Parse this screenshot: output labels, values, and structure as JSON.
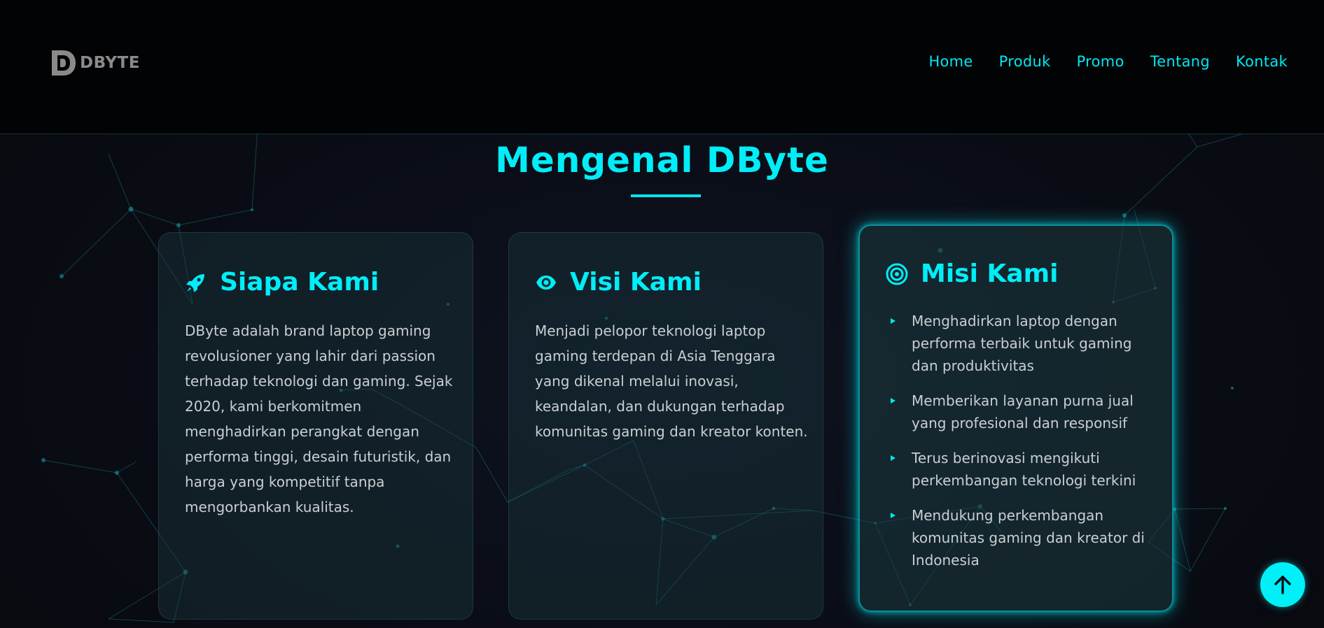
{
  "brand": {
    "logo_text": "DBYTE"
  },
  "nav": {
    "items": [
      "Home",
      "Produk",
      "Promo",
      "Tentang",
      "Kontak"
    ]
  },
  "section": {
    "title": "Mengenal DByte"
  },
  "cards": [
    {
      "icon": "rocket-icon",
      "title": "Siapa Kami",
      "text": "DByte adalah brand laptop gaming revolusioner yang lahir dari passion terhadap teknologi dan gaming. Sejak 2020, kami berkomitmen menghadirkan perangkat dengan performa tinggi, desain futuristik, dan harga yang kompetitif tanpa mengorbankan kualitas."
    },
    {
      "icon": "eye-icon",
      "title": "Visi Kami",
      "text": "Menjadi pelopor teknologi laptop gaming terdepan di Asia Tenggara yang dikenal melalui inovasi, keandalan, dan dukungan terhadap komunitas gaming dan kreator konten."
    },
    {
      "icon": "target-icon",
      "title": "Misi Kami",
      "items": [
        "Menghadirkan laptop dengan performa terbaik untuk gaming dan produktivitas",
        "Memberikan layanan purna jual yang profesional dan responsif",
        "Terus berinovasi mengikuti perkembangan teknologi terkini",
        "Mendukung perkembangan komunitas gaming dan kreator di Indonesia"
      ]
    }
  ],
  "colors": {
    "accent": "#00eef7",
    "header_bg": "#020305",
    "page_bg": "#0a0c14",
    "body_text": "#c9cfd3"
  },
  "back_to_top": {
    "icon": "arrow-up-icon"
  }
}
